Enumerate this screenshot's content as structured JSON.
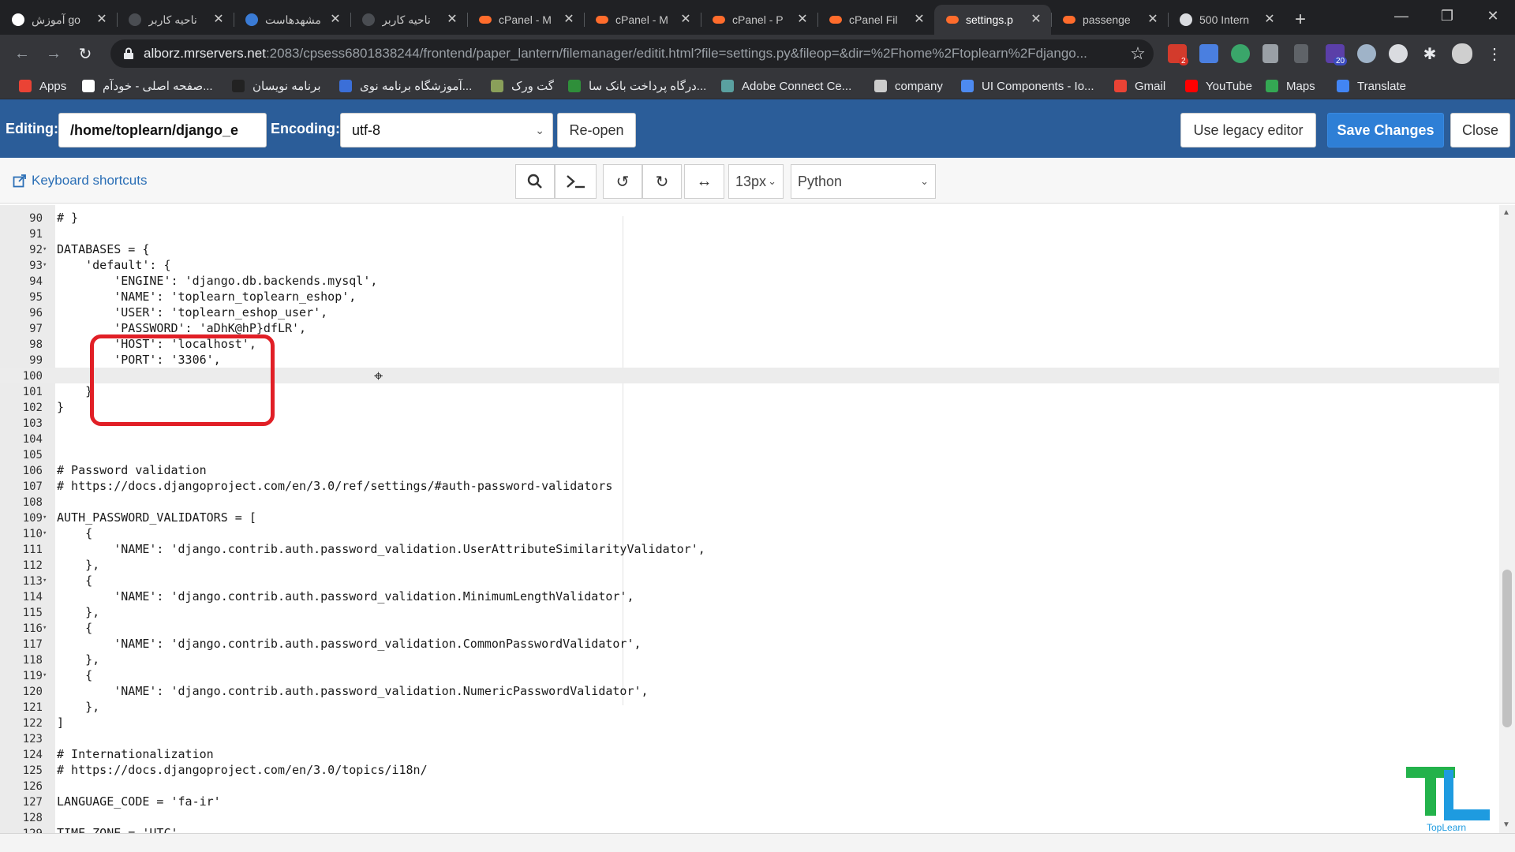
{
  "browser": {
    "tabs": [
      {
        "title": "آموزش go",
        "icon": "toplearn-icon",
        "active": false
      },
      {
        "title": "ناحیه کاربر",
        "icon": "generic-icon",
        "active": false
      },
      {
        "title": "مشهدهاست",
        "icon": "mashhadhost-icon",
        "active": false
      },
      {
        "title": "ناحیه کاربر",
        "icon": "generic-icon",
        "active": false
      },
      {
        "title": "cPanel - M",
        "icon": "cpanel-icon",
        "active": false
      },
      {
        "title": "cPanel - M",
        "icon": "cpanel-icon",
        "active": false
      },
      {
        "title": "cPanel - P",
        "icon": "cpanel-icon",
        "active": false
      },
      {
        "title": "cPanel Fil",
        "icon": "cpanel-icon",
        "active": false
      },
      {
        "title": "settings.p",
        "icon": "cpanel-icon",
        "active": true
      },
      {
        "title": "passenge",
        "icon": "cpanel-icon",
        "active": false
      },
      {
        "title": "500 Intern",
        "icon": "globe-icon",
        "active": false
      }
    ],
    "url_host": "alborz.mrservers.net",
    "url_rest": ":2083/cpsess6801838244/frontend/paper_lantern/filemanager/editit.html?file=settings.py&fileop=&dir=%2Fhome%2Ftoplearn%2Fdjango...",
    "extension_badges": {
      "mail": "2",
      "other": "20"
    },
    "bookmarks": [
      {
        "label": "Apps",
        "color": "#ea4335"
      },
      {
        "label": "صفحه اصلی - خودآم...",
        "color": "#ffffff"
      },
      {
        "label": "برنامه نویسان",
        "color": "#222222"
      },
      {
        "label": "آموزشگاه برنامه نوی...",
        "color": "#3b6fd8"
      },
      {
        "label": "گت ورک",
        "color": "#8aa05a"
      },
      {
        "label": "درگاه پرداخت بانک سا...",
        "color": "#2f8f3a"
      },
      {
        "label": "Adobe Connect Ce...",
        "color": "#5aa0a0"
      },
      {
        "label": "company",
        "color": "#cccccc"
      },
      {
        "label": "UI Components - Io...",
        "color": "#4d8af0"
      },
      {
        "label": "Gmail",
        "color": "#ea4335"
      },
      {
        "label": "YouTube",
        "color": "#ff0000"
      },
      {
        "label": "Maps",
        "color": "#34a853"
      },
      {
        "label": "Translate",
        "color": "#4285f4"
      }
    ]
  },
  "editor_toolbar": {
    "editing_label": "Editing:",
    "path": "/home/toplearn/django_e",
    "encoding_label": "Encoding:",
    "encoding": "utf-8",
    "reopen": "Re-open",
    "legacy": "Use legacy editor",
    "save": "Save Changes",
    "close": "Close"
  },
  "sub_toolbar": {
    "keyboard_shortcuts": "Keyboard shortcuts",
    "font_size": "13px",
    "mode": "Python"
  },
  "code_lines": [
    {
      "n": "90",
      "text": "# }",
      "fold": false
    },
    {
      "n": "91",
      "text": "",
      "fold": false
    },
    {
      "n": "92",
      "text": "DATABASES = {",
      "fold": true
    },
    {
      "n": "93",
      "text": "    'default': {",
      "fold": true
    },
    {
      "n": "94",
      "text": "        'ENGINE': 'django.db.backends.mysql',",
      "fold": false
    },
    {
      "n": "95",
      "text": "        'NAME': 'toplearn_toplearn_eshop',",
      "fold": false
    },
    {
      "n": "96",
      "text": "        'USER': 'toplearn_eshop_user',",
      "fold": false
    },
    {
      "n": "97",
      "text": "        'PASSWORD': 'aDhK@hP}dfLR',",
      "fold": false
    },
    {
      "n": "98",
      "text": "        'HOST': 'localhost',",
      "fold": false
    },
    {
      "n": "99",
      "text": "        'PORT': '3306',",
      "fold": false
    },
    {
      "n": "100",
      "text": "",
      "fold": false,
      "active": true
    },
    {
      "n": "101",
      "text": "    }",
      "fold": false
    },
    {
      "n": "102",
      "text": "}",
      "fold": false
    },
    {
      "n": "103",
      "text": "",
      "fold": false
    },
    {
      "n": "104",
      "text": "",
      "fold": false
    },
    {
      "n": "105",
      "text": "",
      "fold": false
    },
    {
      "n": "106",
      "text": "# Password validation",
      "fold": false
    },
    {
      "n": "107",
      "text": "# https://docs.djangoproject.com/en/3.0/ref/settings/#auth-password-validators",
      "fold": false
    },
    {
      "n": "108",
      "text": "",
      "fold": false
    },
    {
      "n": "109",
      "text": "AUTH_PASSWORD_VALIDATORS = [",
      "fold": true
    },
    {
      "n": "110",
      "text": "    {",
      "fold": true
    },
    {
      "n": "111",
      "text": "        'NAME': 'django.contrib.auth.password_validation.UserAttributeSimilarityValidator',",
      "fold": false
    },
    {
      "n": "112",
      "text": "    },",
      "fold": false
    },
    {
      "n": "113",
      "text": "    {",
      "fold": true
    },
    {
      "n": "114",
      "text": "        'NAME': 'django.contrib.auth.password_validation.MinimumLengthValidator',",
      "fold": false
    },
    {
      "n": "115",
      "text": "    },",
      "fold": false
    },
    {
      "n": "116",
      "text": "    {",
      "fold": true
    },
    {
      "n": "117",
      "text": "        'NAME': 'django.contrib.auth.password_validation.CommonPasswordValidator',",
      "fold": false
    },
    {
      "n": "118",
      "text": "    },",
      "fold": false
    },
    {
      "n": "119",
      "text": "    {",
      "fold": true
    },
    {
      "n": "120",
      "text": "        'NAME': 'django.contrib.auth.password_validation.NumericPasswordValidator',",
      "fold": false
    },
    {
      "n": "121",
      "text": "    },",
      "fold": false
    },
    {
      "n": "122",
      "text": "]",
      "fold": false
    },
    {
      "n": "123",
      "text": "",
      "fold": false
    },
    {
      "n": "124",
      "text": "# Internationalization",
      "fold": false
    },
    {
      "n": "125",
      "text": "# https://docs.djangoproject.com/en/3.0/topics/i18n/",
      "fold": false
    },
    {
      "n": "126",
      "text": "",
      "fold": false
    },
    {
      "n": "127",
      "text": "LANGUAGE_CODE = 'fa-ir'",
      "fold": false
    },
    {
      "n": "128",
      "text": "",
      "fold": false
    },
    {
      "n": "129",
      "text": "TIME_ZONE = 'UTC'",
      "fold": false
    }
  ],
  "watermark": {
    "brand": "TopLearn"
  }
}
